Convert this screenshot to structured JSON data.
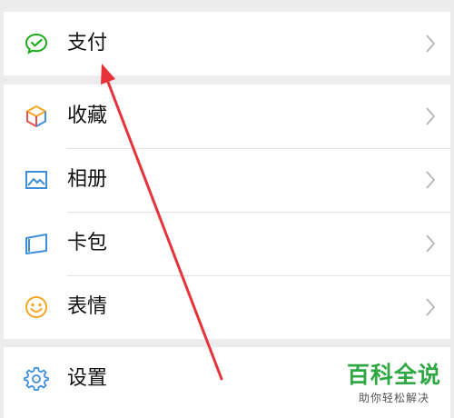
{
  "menu": {
    "group1": [
      {
        "label": "支付",
        "icon": "wechat-pay-icon"
      }
    ],
    "group2": [
      {
        "label": "收藏",
        "icon": "favorites-cube-icon"
      },
      {
        "label": "相册",
        "icon": "photo-album-icon"
      },
      {
        "label": "卡包",
        "icon": "card-wallet-icon"
      },
      {
        "label": "表情",
        "icon": "smiley-face-icon"
      }
    ],
    "group3": [
      {
        "label": "设置",
        "icon": "settings-gear-icon"
      }
    ]
  },
  "watermark": {
    "title": "百科全说",
    "subtitle": "助你轻松解决"
  },
  "colors": {
    "pay_green": "#1aad19",
    "annotation_arrow": "#e8323a",
    "watermark_green": "#2fa843"
  }
}
